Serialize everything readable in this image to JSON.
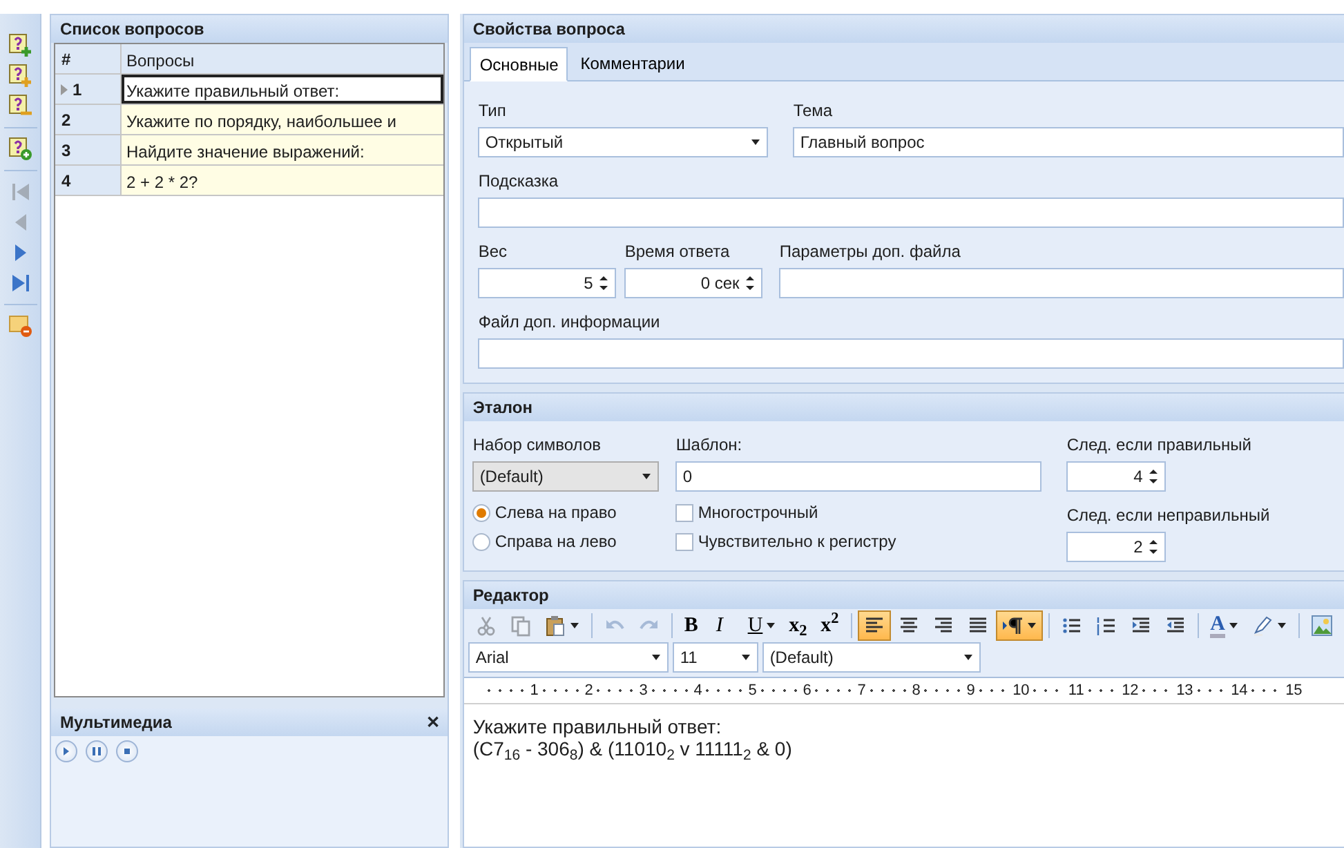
{
  "left_toolbar": [
    {
      "kind": "question-add",
      "disabled": false
    },
    {
      "kind": "question-insert",
      "disabled": false
    },
    {
      "kind": "question-remove",
      "disabled": false
    },
    {
      "kind": "separator"
    },
    {
      "kind": "question-copy",
      "disabled": false
    },
    {
      "kind": "separator"
    },
    {
      "kind": "first",
      "disabled": true
    },
    {
      "kind": "prev",
      "disabled": true
    },
    {
      "kind": "next",
      "disabled": false
    },
    {
      "kind": "last",
      "disabled": false
    },
    {
      "kind": "separator"
    },
    {
      "kind": "note-delete",
      "disabled": false
    }
  ],
  "question_list": {
    "title": "Список вопросов",
    "columns": [
      "#",
      "Вопросы"
    ],
    "rows": [
      {
        "number": "1",
        "text": "Укажите правильный ответ:",
        "selected": true
      },
      {
        "number": "2",
        "text": "Укажите по порядку, наибольшее и",
        "selected": false
      },
      {
        "number": "3",
        "text": "Найдите значение выражений:",
        "selected": false
      },
      {
        "number": "4",
        "text": "2 + 2 * 2?",
        "selected": false
      }
    ]
  },
  "multimedia": {
    "title": "Мультимедиа",
    "close": "✕",
    "buttons": [
      {
        "kind": "play"
      },
      {
        "kind": "pause"
      },
      {
        "kind": "stop"
      }
    ]
  },
  "properties": {
    "title": "Свойства вопроса",
    "tabs": [
      {
        "label": "Основные",
        "selected": true
      },
      {
        "label": "Комментарии",
        "selected": false
      }
    ],
    "type": {
      "label": "Тип",
      "value": "Открытый"
    },
    "topic": {
      "label": "Тема",
      "value": "Главный вопрос"
    },
    "hint": {
      "label": "Подсказка"
    },
    "weight": {
      "label": "Вес",
      "value": "5"
    },
    "answer_time": {
      "label": "Время ответа",
      "value": "0 сек"
    },
    "file_params": {
      "label": "Параметры доп. файла"
    },
    "info_file": {
      "label": "Файл доп. информации"
    }
  },
  "etalon": {
    "title": "Эталон",
    "charset": {
      "label": "Набор символов",
      "value": "(Default)"
    },
    "template": {
      "label": "Шаблон:",
      "value": "0"
    },
    "next_correct": {
      "label": "След. если правильный",
      "value": "4"
    },
    "next_wrong": {
      "label": "След. если неправильный",
      "value": "2"
    },
    "direction": [
      {
        "label": "Слева на право",
        "selected": true
      },
      {
        "label": "Справа на лево",
        "selected": false
      }
    ],
    "options": [
      {
        "label": "Многострочный",
        "checked": false
      },
      {
        "label": "Чувствительно к регистру",
        "checked": false
      }
    ]
  },
  "editor": {
    "title": "Редактор",
    "toolbar": [
      {
        "kind": "cut",
        "disabled": true,
        "active": false
      },
      {
        "kind": "copy",
        "disabled": true,
        "active": false
      },
      {
        "kind": "paste",
        "disabled": false,
        "active": false,
        "dropdown": true
      },
      {
        "kind": "separator"
      },
      {
        "kind": "undo",
        "disabled": true,
        "active": false
      },
      {
        "kind": "redo",
        "disabled": true,
        "active": false
      },
      {
        "kind": "separator"
      },
      {
        "kind": "bold",
        "label": "B",
        "disabled": false,
        "active": false
      },
      {
        "kind": "italic",
        "label": "I",
        "disabled": false,
        "active": false
      },
      {
        "kind": "underline",
        "label": "U",
        "disabled": false,
        "active": false,
        "dropdown": true
      },
      {
        "kind": "subscript",
        "label": "x$_{2}$",
        "disabled": false,
        "active": false
      },
      {
        "kind": "superscript",
        "label": "x$^{2}$",
        "disabled": false,
        "active": false
      },
      {
        "kind": "separator"
      },
      {
        "kind": "align-left",
        "disabled": false,
        "active": true
      },
      {
        "kind": "align-center",
        "disabled": false,
        "active": false
      },
      {
        "kind": "align-right",
        "disabled": false,
        "active": false
      },
      {
        "kind": "align-justify",
        "disabled": false,
        "active": false
      },
      {
        "kind": "paragraph",
        "disabled": false,
        "active": true,
        "dropdown": true
      },
      {
        "kind": "separator"
      },
      {
        "kind": "bullets",
        "disabled": false,
        "active": false
      },
      {
        "kind": "numbering",
        "disabled": false,
        "active": false
      },
      {
        "kind": "indent",
        "disabled": false,
        "active": false
      },
      {
        "kind": "outdent",
        "disabled": false,
        "active": false
      },
      {
        "kind": "separator"
      },
      {
        "kind": "font-color",
        "label": "A",
        "disabled": false,
        "active": false,
        "dropdown": true
      },
      {
        "kind": "highlight",
        "disabled": false,
        "active": false,
        "dropdown": true
      },
      {
        "kind": "separator"
      },
      {
        "kind": "image",
        "disabled": false,
        "active": false
      }
    ],
    "font": "Arial",
    "size": "11",
    "style": "(Default)",
    "ruler": [
      "1",
      "2",
      "3",
      "4",
      "5",
      "6",
      "7",
      "8",
      "9",
      "10",
      "11",
      "12",
      "13",
      "14",
      "15"
    ],
    "content": [
      "Укажите правильный ответ:",
      "(C7$_{16}$  - 306$_{8}$) & (11010$_{2}$ v 11111$_{2}$ & 0)"
    ]
  }
}
